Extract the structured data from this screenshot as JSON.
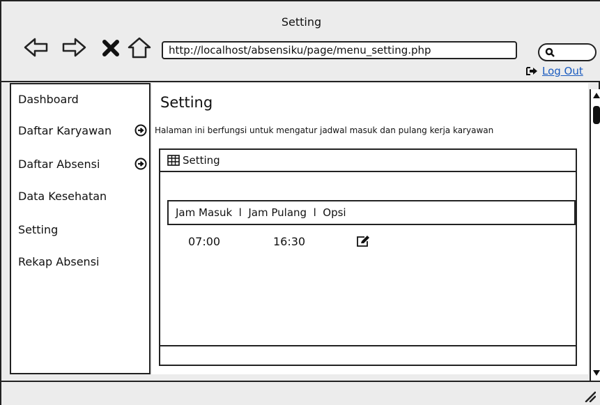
{
  "window": {
    "title": "Setting"
  },
  "toolbar": {
    "url": "http://localhost/absensiku/page/menu_setting.php",
    "logout_label": "Log Out"
  },
  "sidebar": {
    "items": [
      {
        "label": "Dashboard",
        "has_arrow": false
      },
      {
        "label": "Daftar Karyawan",
        "has_arrow": true
      },
      {
        "label": "Daftar Absensi",
        "has_arrow": true
      },
      {
        "label": "Data Kesehatan",
        "has_arrow": false
      },
      {
        "label": "Setting",
        "has_arrow": false
      },
      {
        "label": "Rekap Absensi",
        "has_arrow": false
      }
    ]
  },
  "main": {
    "title": "Setting",
    "description": "Halaman ini berfungsi untuk mengatur jadwal masuk dan pulang kerja karyawan",
    "panel": {
      "title": "Setting",
      "header_text": "Jam Masuk  l  Jam Pulang  l  Opsi",
      "row": {
        "jam_masuk": "07:00",
        "jam_pulang": "16:30"
      }
    }
  }
}
